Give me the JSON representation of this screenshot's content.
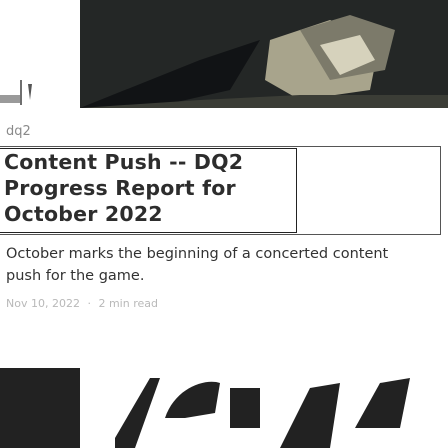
{
  "card": {
    "tag": "dq2",
    "title": "Content Push -- DQ2 Progress Report for October 2022",
    "description": "October marks the beginning of a concerted content push for the game.",
    "date": "Nov 10, 2022",
    "separator": "·",
    "read_time": "2 min read"
  },
  "images": {
    "hero": "game-artwork-thumbnail",
    "bottom": "game-artwork-strip"
  }
}
